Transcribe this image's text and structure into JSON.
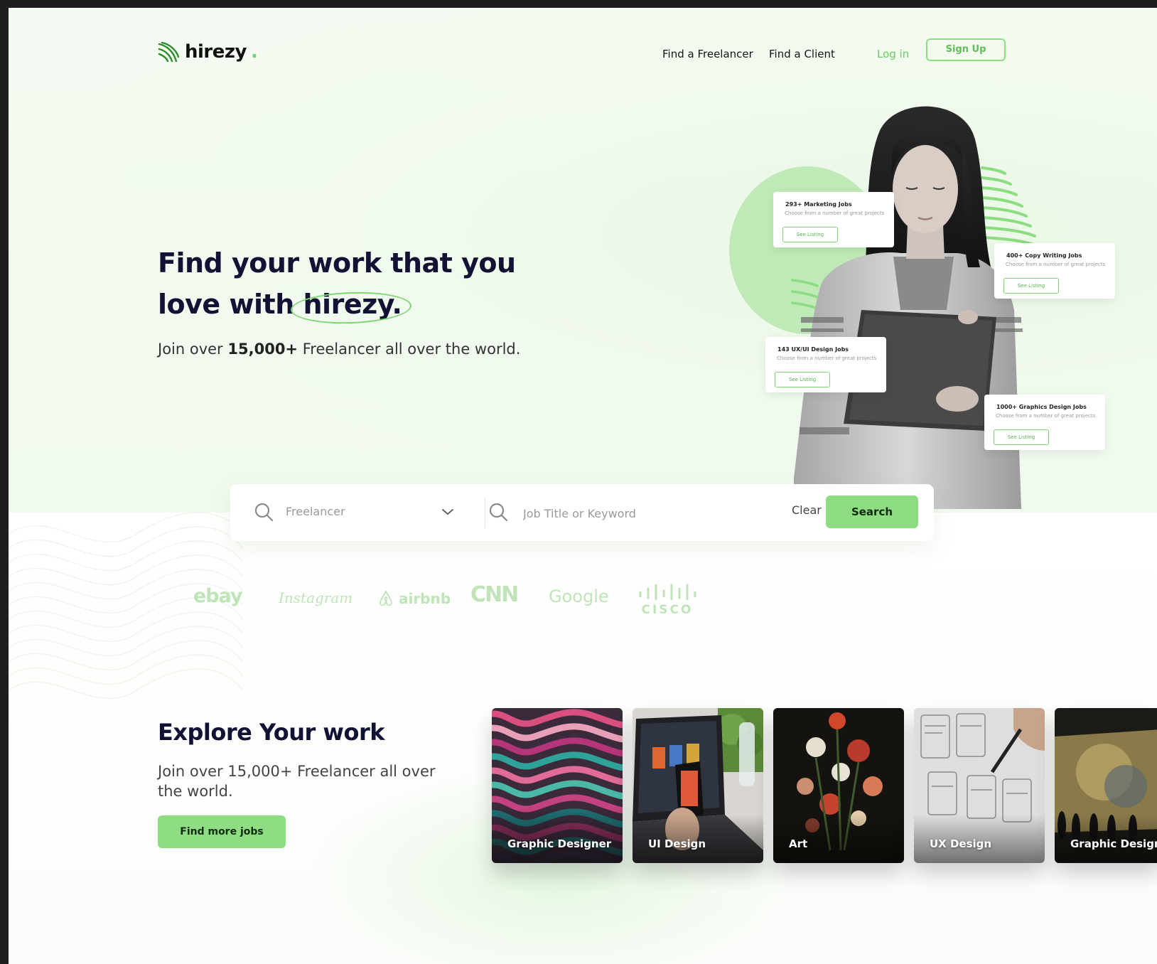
{
  "brand": {
    "name": "hirezy",
    "dot": "."
  },
  "nav": {
    "find_freelancer": "Find a Freelancer",
    "find_client": "Find a Client",
    "login": "Log in",
    "signup": "Sign Up"
  },
  "hero": {
    "title_line1": "Find your work that you",
    "title_line2_prefix": "love with",
    "title_brand": "hirezy.",
    "subtitle_prefix": "Join over",
    "subtitle_count": "15,000+",
    "subtitle_suffix": "Freelancer all over the world."
  },
  "job_cards": [
    {
      "title": "293+ Marketing Jobs",
      "subtitle": "Choose from a number of great projects",
      "button": "See Listing"
    },
    {
      "title": "400+ Copy Writing Jobs",
      "subtitle": "Choose from a number of great projects",
      "button": "See Listing"
    },
    {
      "title": "143 UX/UI Design Jobs",
      "subtitle": "Choose from a number of great projects",
      "button": "See Listing"
    },
    {
      "title": "1000+ Graphics Design Jobs",
      "subtitle": "Choose from a number of great projects",
      "button": "See Listing"
    }
  ],
  "search": {
    "category_value": "Freelancer",
    "keyword_placeholder": "Job Title or Keyword",
    "clear_label": "Clear",
    "search_label": "Search"
  },
  "partners": [
    "ebay",
    "Instagram",
    "airbnb",
    "CNN",
    "Google",
    "CISCO"
  ],
  "explore": {
    "title": "Explore Your work",
    "subtitle": "Join over 15,000+ Freelancer all over the world.",
    "button": "Find more jobs",
    "categories": [
      "Graphic Designer",
      "UI Design",
      "Art",
      "UX Design",
      "Graphic Designe"
    ]
  },
  "colors": {
    "accent": "#8fdd82",
    "accent_dark": "#5fbf54",
    "heading": "#121235"
  }
}
